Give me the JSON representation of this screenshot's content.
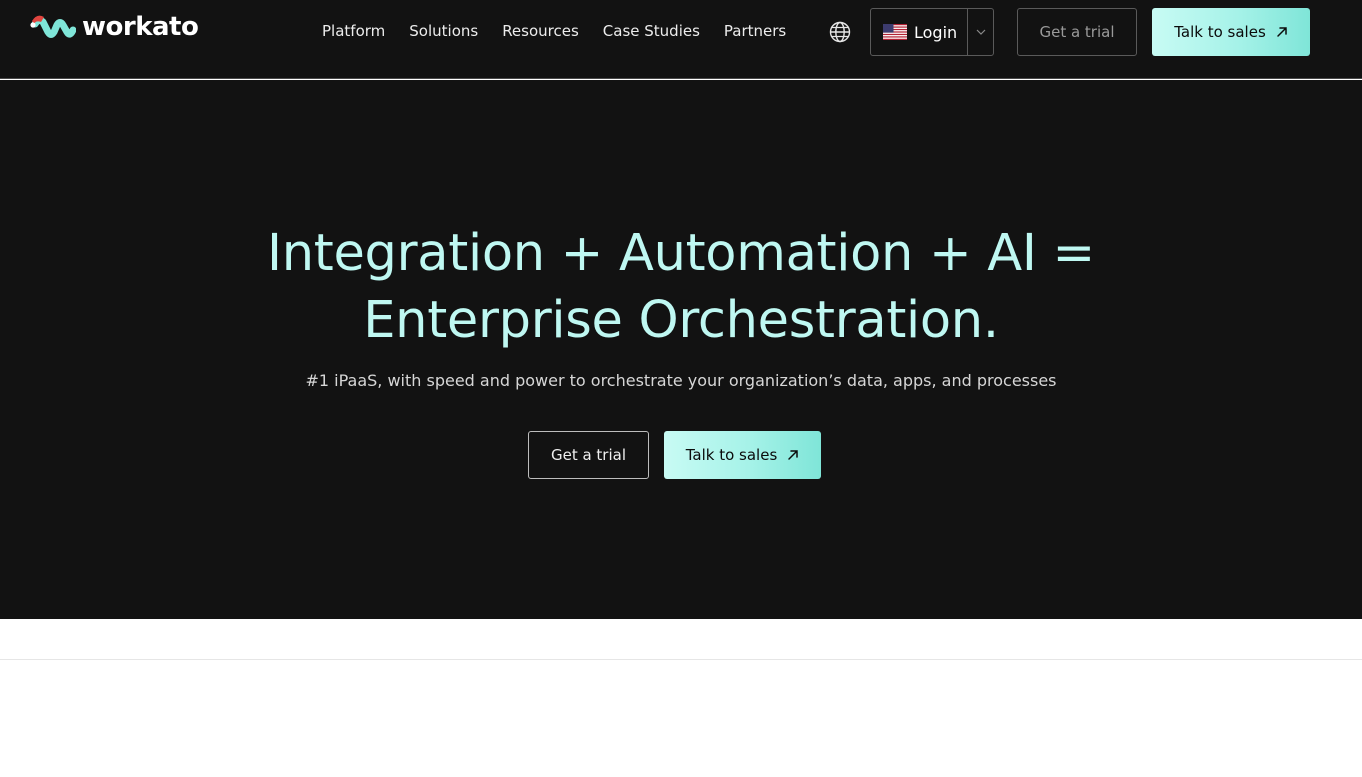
{
  "brand": {
    "name": "workato",
    "logo_icon": "workato-logo-mark",
    "colors": {
      "accent": "#a5f2e8",
      "hero_text": "#bff8f2",
      "background": "#121212"
    }
  },
  "nav": {
    "items": [
      {
        "label": "Platform"
      },
      {
        "label": "Solutions"
      },
      {
        "label": "Resources"
      },
      {
        "label": "Case Studies"
      },
      {
        "label": "Partners"
      }
    ]
  },
  "header": {
    "globe_icon": "globe-icon",
    "flag_icon": "us-flag-icon",
    "login_label": "Login",
    "login_menu_icon": "chevron-down-icon",
    "trial_label": "Get a trial",
    "sales_label": "Talk to sales",
    "sales_icon": "arrow-up-right-icon"
  },
  "hero": {
    "title_line1": "Integration + Automation + AI =",
    "title_line2": "Enterprise Orchestration.",
    "subtitle": "#1 iPaaS, with speed and power to orchestrate your organization’s data, apps, and processes",
    "trial_label": "Get a trial",
    "sales_label": "Talk to sales"
  }
}
